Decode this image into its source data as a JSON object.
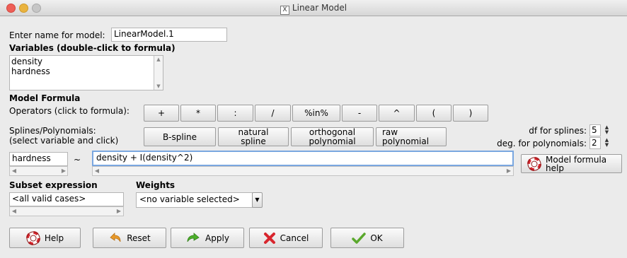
{
  "window": {
    "title": "Linear Model"
  },
  "model_name": {
    "label": "Enter name for model:",
    "value": "LinearModel.1"
  },
  "variables": {
    "heading": "Variables (double-click to formula)",
    "items": [
      "density",
      "hardness"
    ]
  },
  "model_formula": {
    "heading": "Model Formula",
    "operators_label": "Operators (click to formula):",
    "operators": [
      "+",
      "*",
      ":",
      "/",
      "%in%",
      "-",
      "^",
      "(",
      ")"
    ],
    "splines_label_1": "Splines/Polynomials:",
    "splines_label_2": "(select variable and click)",
    "spline_buttons": [
      {
        "line1": "B-spline",
        "line2": ""
      },
      {
        "line1": "natural",
        "line2": "spline"
      },
      {
        "line1": "orthogonal",
        "line2": "polynomial"
      },
      {
        "line1": "raw",
        "line2": "polynomial"
      }
    ],
    "df_splines_label": "df for splines:",
    "df_splines_value": "5",
    "deg_poly_label": "deg. for polynomials:",
    "deg_poly_value": "2",
    "lhs": "hardness",
    "tilde": "~",
    "rhs": "density + I(density^2)",
    "help_button_line1": "Model formula",
    "help_button_line2": "help"
  },
  "subset": {
    "heading": "Subset expression",
    "value": "<all valid cases>"
  },
  "weights": {
    "heading": "Weights",
    "value": "<no variable selected>"
  },
  "buttons": {
    "help": "Help",
    "reset": "Reset",
    "apply": "Apply",
    "cancel": "Cancel",
    "ok": "OK"
  },
  "colors": {
    "focus_border": "#7aa7e0",
    "cancel_red": "#d8262e",
    "ok_green": "#5aa82c",
    "apply_green": "#4caf2a",
    "reset_orange": "#e89a2a"
  }
}
